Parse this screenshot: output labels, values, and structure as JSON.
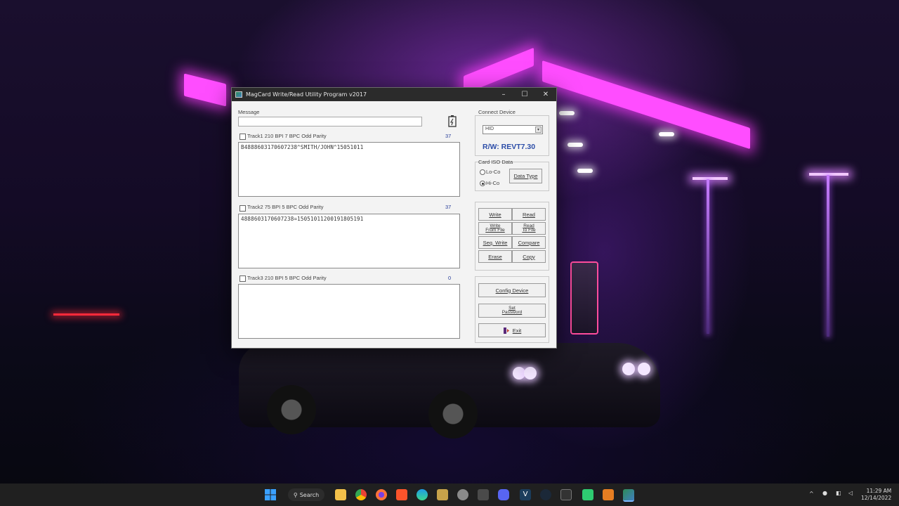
{
  "window": {
    "title": "MagCard Write/Read Utility Program  v2017",
    "minimize": "–",
    "maximize": "☐",
    "close": "✕"
  },
  "message": {
    "label": "Message",
    "value": ""
  },
  "tracks": [
    {
      "label": "Track1   210 BPI  7 BPC  Odd Parity",
      "count": "37",
      "data": "B4888603170607238^SMITH/JOHN^15051011"
    },
    {
      "label": "Track2   75 BPI  5 BPC  Odd Parity",
      "count": "37",
      "data": "4888603170607238=15051011200191805191"
    },
    {
      "label": "Track3   210 BPI  5 BPC  Odd Parity",
      "count": "0",
      "data": ""
    }
  ],
  "connect": {
    "label": "Connect Device",
    "selected": "HID",
    "status": "R/W: REVT7.30"
  },
  "card_iso": {
    "label": "Card  ISO Data",
    "options": [
      {
        "label": "Lo-Co",
        "selected": false
      },
      {
        "label": "Hi-Co",
        "selected": true
      }
    ],
    "data_type_label": "Data Type"
  },
  "actions": {
    "write": "Write",
    "read": "Read",
    "write_from_file_1": "Write",
    "write_from_file_2": "From File",
    "read_to_file_1": "Read",
    "read_to_file_2": "To File",
    "seq_write": "Seq. Write",
    "compare": "Compare",
    "erase": "Erase",
    "copy": "Copy"
  },
  "device": {
    "config": "Config Device",
    "set_password_1": "Set",
    "set_password_2": "Password",
    "exit": "Exit"
  },
  "taskbar": {
    "search": "Search",
    "time": "11:29 AM",
    "date": "12/14/2022"
  },
  "colors": {
    "accent": "#2d4ea8",
    "titlebar": "#2b2b2b",
    "taskbar": "#202020"
  }
}
